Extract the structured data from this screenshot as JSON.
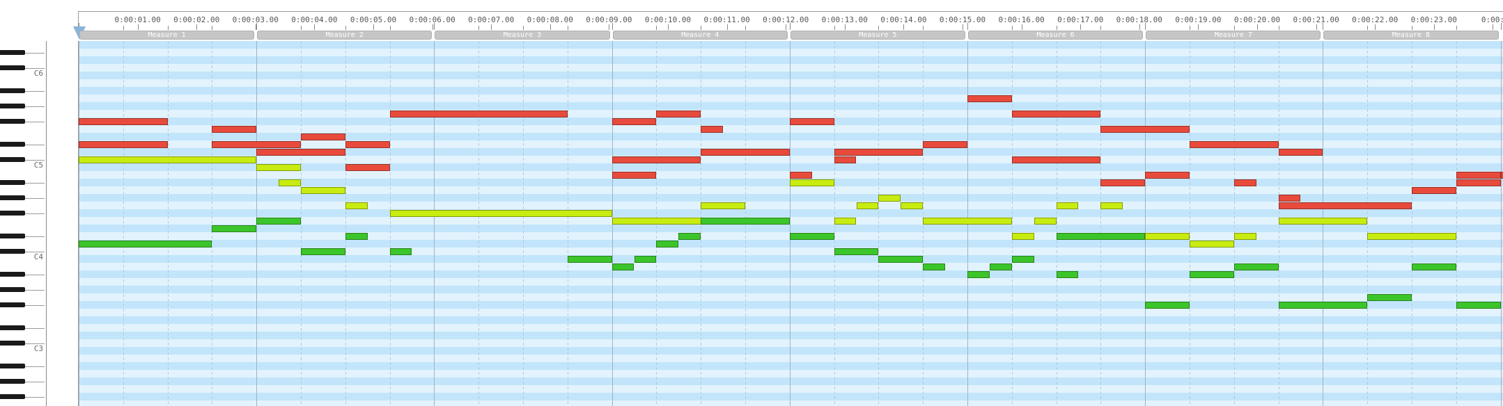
{
  "time_labels": [
    "0:00:01.00",
    "0:00:02.00",
    "0:00:03.00",
    "0:00:04.00",
    "0:00:05.00",
    "0:00:06.00",
    "0:00:07.00",
    "0:00:08.00",
    "0:00:09.00",
    "0:00:10.00",
    "0:00:11.00",
    "0:00:12.00",
    "0:00:13.00",
    "0:00:14.00",
    "0:00:15.00",
    "0:00:16.00",
    "0:00:17.00",
    "0:00:18.00",
    "0:00:19.00",
    "0:00:20.00",
    "0:00:21.00",
    "0:00:22.00",
    "0:00:23.00",
    "0:00:"
  ],
  "measures": [
    "Measure 1",
    "Measure 2",
    "Measure 3",
    "Measure 4",
    "Measure 5",
    "Measure 6",
    "Measure 7",
    "Measure 8"
  ],
  "octave_labels": [
    "C6",
    "C5",
    "C4",
    "C3"
  ],
  "colors": {
    "row_light": "#e2f3fd",
    "row_dark": "#c2e5fb",
    "measure_line": "#9fb1c4",
    "beat_line": "#b4c9dc",
    "melody": "#e84b3c",
    "harmony": "#c8ec10",
    "bass": "#3cc52a",
    "measure_bar": "#c6c6c6"
  },
  "notes": {
    "melody": [
      {
        "start": 0,
        "dur": 2,
        "pitch": 78
      },
      {
        "start": 3,
        "dur": 1,
        "pitch": 77
      },
      {
        "start": 0,
        "dur": 2,
        "pitch": 75
      },
      {
        "start": 3,
        "dur": 2,
        "pitch": 75
      },
      {
        "start": 5,
        "dur": 1,
        "pitch": 76
      },
      {
        "start": 6,
        "dur": 1,
        "pitch": 75
      },
      {
        "start": 4,
        "dur": 2,
        "pitch": 74
      },
      {
        "start": 6,
        "dur": 1,
        "pitch": 72
      },
      {
        "start": 7,
        "dur": 4,
        "pitch": 79
      },
      {
        "start": 12,
        "dur": 1,
        "pitch": 78
      },
      {
        "start": 13,
        "dur": 1,
        "pitch": 79
      },
      {
        "start": 14,
        "dur": 0.5,
        "pitch": 77
      },
      {
        "start": 12,
        "dur": 2,
        "pitch": 73
      },
      {
        "start": 14,
        "dur": 2,
        "pitch": 74
      },
      {
        "start": 12,
        "dur": 1,
        "pitch": 71
      },
      {
        "start": 16,
        "dur": 1,
        "pitch": 78
      },
      {
        "start": 16,
        "dur": 0.5,
        "pitch": 71
      },
      {
        "start": 17,
        "dur": 2,
        "pitch": 74
      },
      {
        "start": 17,
        "dur": 0.5,
        "pitch": 73
      },
      {
        "start": 19,
        "dur": 1,
        "pitch": 75
      },
      {
        "start": 20,
        "dur": 1,
        "pitch": 81
      },
      {
        "start": 21,
        "dur": 2,
        "pitch": 79
      },
      {
        "start": 21,
        "dur": 2,
        "pitch": 73
      },
      {
        "start": 23,
        "dur": 2,
        "pitch": 77
      },
      {
        "start": 23,
        "dur": 1,
        "pitch": 70
      },
      {
        "start": 25,
        "dur": 2,
        "pitch": 75
      },
      {
        "start": 24,
        "dur": 1,
        "pitch": 71
      },
      {
        "start": 26,
        "dur": 0.5,
        "pitch": 70
      },
      {
        "start": 27,
        "dur": 1,
        "pitch": 74
      },
      {
        "start": 27,
        "dur": 0.5,
        "pitch": 68
      },
      {
        "start": 27,
        "dur": 3,
        "pitch": 67
      },
      {
        "start": 30,
        "dur": 1,
        "pitch": 69
      },
      {
        "start": 31,
        "dur": 1,
        "pitch": 71
      },
      {
        "start": 31,
        "dur": 1,
        "pitch": 70
      },
      {
        "start": 32,
        "dur": 1,
        "pitch": 71
      }
    ],
    "harmony": [
      {
        "start": 0,
        "dur": 4,
        "pitch": 73
      },
      {
        "start": 4,
        "dur": 1,
        "pitch": 72
      },
      {
        "start": 4.5,
        "dur": 0.5,
        "pitch": 70
      },
      {
        "start": 5,
        "dur": 1,
        "pitch": 69
      },
      {
        "start": 6,
        "dur": 0.5,
        "pitch": 67
      },
      {
        "start": 7,
        "dur": 5,
        "pitch": 66
      },
      {
        "start": 12,
        "dur": 4,
        "pitch": 65
      },
      {
        "start": 14,
        "dur": 1,
        "pitch": 67
      },
      {
        "start": 16,
        "dur": 1,
        "pitch": 70
      },
      {
        "start": 17,
        "dur": 0.5,
        "pitch": 65
      },
      {
        "start": 17.5,
        "dur": 0.5,
        "pitch": 67
      },
      {
        "start": 18,
        "dur": 0.5,
        "pitch": 68
      },
      {
        "start": 18.5,
        "dur": 0.5,
        "pitch": 67
      },
      {
        "start": 19,
        "dur": 2,
        "pitch": 65
      },
      {
        "start": 21,
        "dur": 0.5,
        "pitch": 63
      },
      {
        "start": 21.5,
        "dur": 0.5,
        "pitch": 65
      },
      {
        "start": 22,
        "dur": 0.5,
        "pitch": 67
      },
      {
        "start": 23,
        "dur": 0.5,
        "pitch": 67
      },
      {
        "start": 24,
        "dur": 1,
        "pitch": 63
      },
      {
        "start": 25,
        "dur": 1,
        "pitch": 62
      },
      {
        "start": 26,
        "dur": 0.5,
        "pitch": 63
      },
      {
        "start": 27,
        "dur": 2,
        "pitch": 65
      },
      {
        "start": 29,
        "dur": 2,
        "pitch": 63
      }
    ],
    "bass": [
      {
        "start": 0,
        "dur": 3,
        "pitch": 62
      },
      {
        "start": 3,
        "dur": 1,
        "pitch": 64
      },
      {
        "start": 4,
        "dur": 1,
        "pitch": 65
      },
      {
        "start": 5,
        "dur": 1,
        "pitch": 61
      },
      {
        "start": 6,
        "dur": 0.5,
        "pitch": 63
      },
      {
        "start": 7,
        "dur": 0.5,
        "pitch": 61
      },
      {
        "start": 11,
        "dur": 1,
        "pitch": 60
      },
      {
        "start": 12,
        "dur": 0.5,
        "pitch": 59
      },
      {
        "start": 12.5,
        "dur": 0.5,
        "pitch": 60
      },
      {
        "start": 13,
        "dur": 0.5,
        "pitch": 62
      },
      {
        "start": 13.5,
        "dur": 0.5,
        "pitch": 63
      },
      {
        "start": 14,
        "dur": 2,
        "pitch": 65
      },
      {
        "start": 16,
        "dur": 1,
        "pitch": 63
      },
      {
        "start": 17,
        "dur": 1,
        "pitch": 61
      },
      {
        "start": 18,
        "dur": 1,
        "pitch": 60
      },
      {
        "start": 19,
        "dur": 0.5,
        "pitch": 59
      },
      {
        "start": 20,
        "dur": 0.5,
        "pitch": 58
      },
      {
        "start": 20.5,
        "dur": 0.5,
        "pitch": 59
      },
      {
        "start": 21,
        "dur": 0.5,
        "pitch": 60
      },
      {
        "start": 22,
        "dur": 0.5,
        "pitch": 58
      },
      {
        "start": 22,
        "dur": 2,
        "pitch": 63
      },
      {
        "start": 24,
        "dur": 1,
        "pitch": 54
      },
      {
        "start": 25,
        "dur": 1,
        "pitch": 58
      },
      {
        "start": 26,
        "dur": 1,
        "pitch": 59
      },
      {
        "start": 27,
        "dur": 2,
        "pitch": 54
      },
      {
        "start": 29,
        "dur": 1,
        "pitch": 55
      },
      {
        "start": 30,
        "dur": 1,
        "pitch": 59
      },
      {
        "start": 31,
        "dur": 1,
        "pitch": 54
      }
    ]
  }
}
